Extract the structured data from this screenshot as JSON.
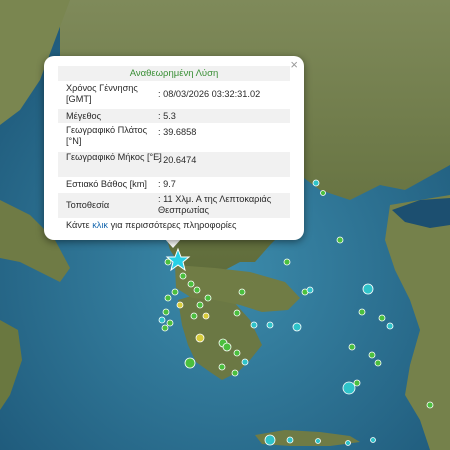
{
  "map": {
    "colors": {
      "sea_deep": "#1f5d82",
      "sea_shallow": "#3f8fb0",
      "land": "#6e7c48",
      "mountain": "#8a7a55",
      "quake_green": "#4bbf3e",
      "quake_cyan": "#2fc3c9",
      "quake_yellow": "#d7cc3a",
      "star": "#27d0e6"
    },
    "epicenter_icon": "star-icon"
  },
  "popup": {
    "title": "Αναθεωρημένη Λύση",
    "close_glyph": "×",
    "rows": [
      {
        "label": "Χρόνος Γέννησης [GMT]",
        "value": ": 08/03/2026 03:32:31.02"
      },
      {
        "label": "Μέγεθος",
        "value": ": 5.3"
      },
      {
        "label": "Γεωγραφικό Πλάτος [°N]",
        "value": ": 39.6858"
      },
      {
        "label": "Γεωγραφικό Μήκος [°E]",
        "value": ": 20.6474"
      },
      {
        "label": "Εστιακό Βάθος [km]",
        "value": ": 9.7"
      },
      {
        "label": "Τοποθεσία",
        "value": ": 11 Χλμ. Α της Λεπτοκαριάς Θεσπρωτίας"
      }
    ],
    "footer_before": "Κάντε ",
    "footer_link": "κλικ",
    "footer_after": " για περισσότερες πληροφορίες"
  }
}
